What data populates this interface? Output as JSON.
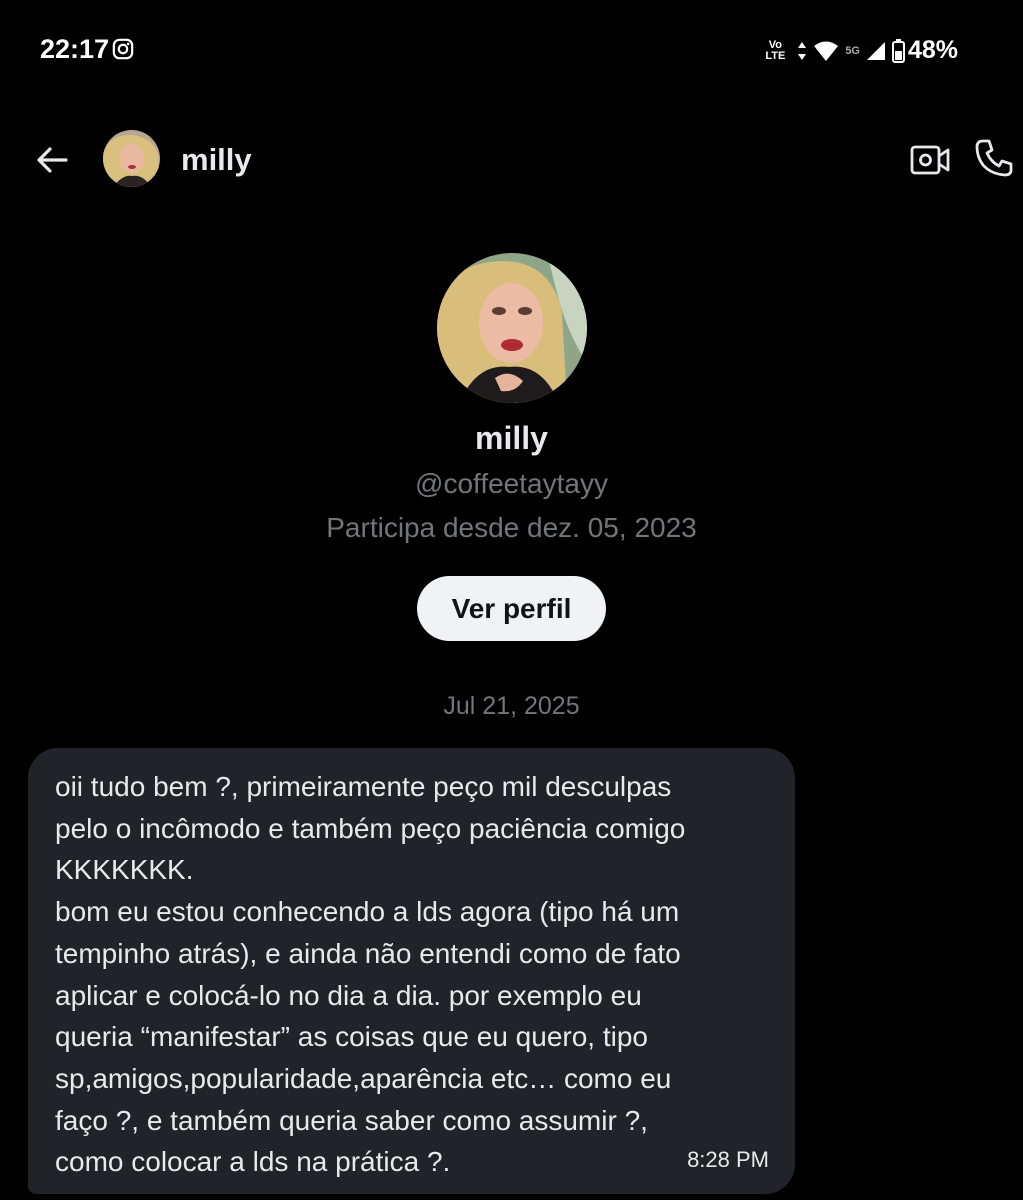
{
  "status_bar": {
    "time": "22:17",
    "notification_icon": "instagram-icon",
    "volte_line1": "Vo",
    "volte_line2": "LTE",
    "network": "5G",
    "battery": "48%"
  },
  "header": {
    "back_icon": "arrow-left-icon",
    "name": "milly",
    "video_icon": "video-camera-icon",
    "phone_icon": "phone-icon"
  },
  "profile": {
    "name": "milly",
    "handle": "@coffeetaytayy",
    "joined": "Participa desde dez. 05, 2023",
    "view_profile_label": "Ver perfil"
  },
  "conversation": {
    "date": "Jul 21, 2025",
    "messages": [
      {
        "text": "oii tudo bem ?, primeiramente peço mil desculpas\npelo o incômodo e também peço paciência comigo\nKKKKKKK.\nbom eu estou conhecendo a lds agora (tipo há um\ntempinho atrás), e ainda não entendi como de fato\naplicar e colocá-lo no dia a dia. por exemplo eu\nqueria “manifestar” as coisas que eu quero, tipo\nsp,amigos,popularidade,aparência etc… como eu\nfaço ?, e também queria saber como assumir ?,\ncomo colocar a lds na prática ?.",
        "time": "8:28 PM"
      }
    ]
  },
  "colors": {
    "background": "#000000",
    "text_primary": "#e7e9ea",
    "text_secondary": "#71767b",
    "bubble": "#202327",
    "button_bg": "#eff3f4"
  }
}
